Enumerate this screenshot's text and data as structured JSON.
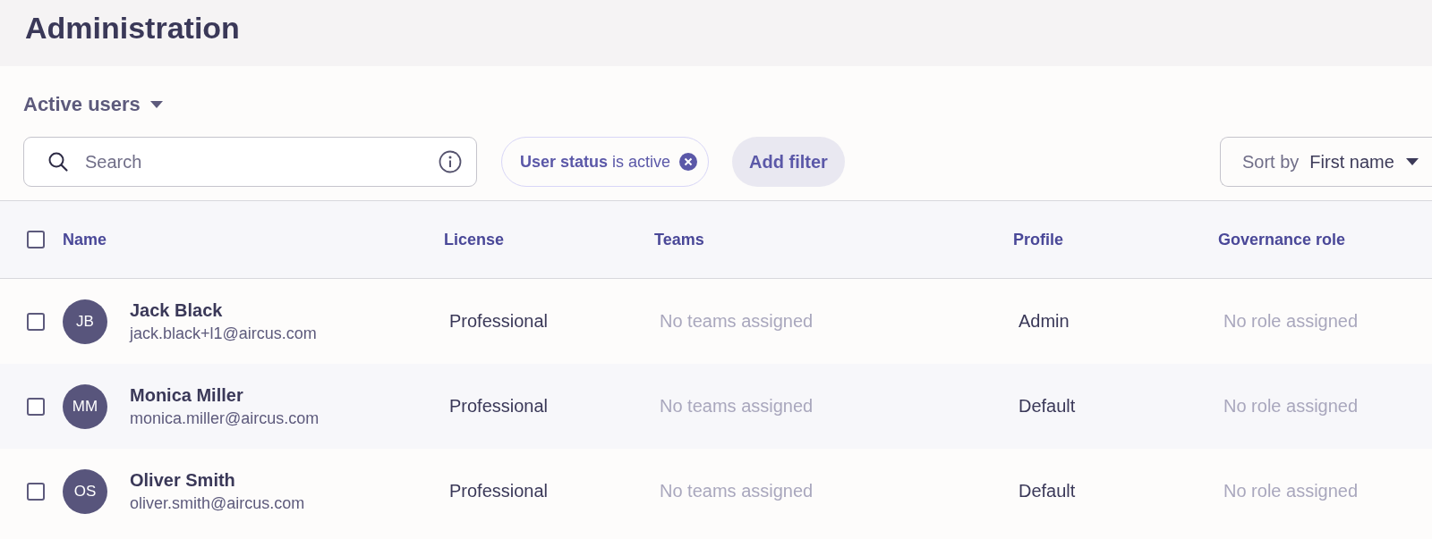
{
  "page_title": "Administration",
  "view_selector": {
    "label": "Active users"
  },
  "search": {
    "placeholder": "Search"
  },
  "filter_chip": {
    "field": "User status",
    "condition": "is active"
  },
  "add_filter": {
    "label": "Add filter"
  },
  "sort": {
    "label": "Sort by",
    "value": "First name"
  },
  "table": {
    "select_all": {
      "checked": false
    },
    "columns": [
      "Name",
      "License",
      "Teams",
      "Profile",
      "Governance role"
    ],
    "rows": [
      {
        "checked": false,
        "initials": "JB",
        "name": "Jack Black",
        "email": "jack.black+l1@aircus.com",
        "license": "Professional",
        "teams": "No teams assigned",
        "profile": "Admin",
        "role": "No role assigned"
      },
      {
        "checked": false,
        "initials": "MM",
        "name": "Monica Miller",
        "email": "monica.miller@aircus.com",
        "license": "Professional",
        "teams": "No teams assigned",
        "profile": "Default",
        "role": "No role assigned"
      },
      {
        "checked": false,
        "initials": "OS",
        "name": "Oliver Smith",
        "email": "oliver.smith@aircus.com",
        "license": "Professional",
        "teams": "No teams assigned",
        "profile": "Default",
        "role": "No role assigned"
      }
    ]
  }
}
